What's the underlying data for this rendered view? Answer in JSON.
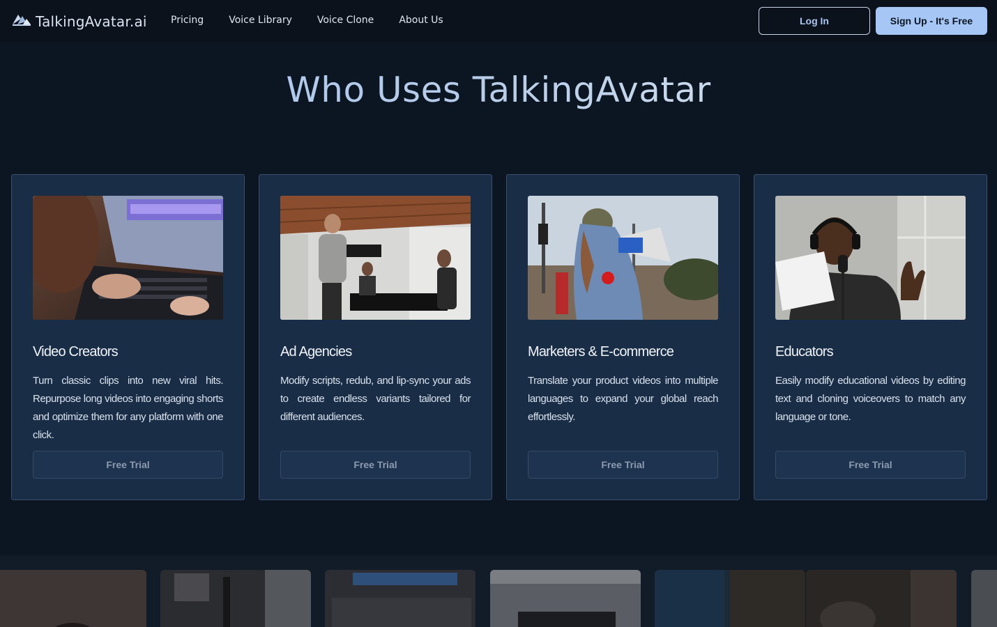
{
  "nav": {
    "brand": "TalkingAvatar.ai",
    "links": [
      "Pricing",
      "Voice Library",
      "Voice Clone",
      "About Us"
    ],
    "login_label": "Log In",
    "signup_label": "Sign Up - It's Free"
  },
  "section": {
    "title": "Who Uses TalkingAvatar"
  },
  "cards": [
    {
      "title": "Video Creators",
      "description": "Turn classic clips into new viral hits. Repurpose long videos into engaging shorts and optimize them for any platform with one click.",
      "button": "Free Trial"
    },
    {
      "title": "Ad Agencies",
      "description": "Modify scripts, redub, and lip-sync your ads to create endless variants tailored for different audiences.",
      "button": "Free Trial"
    },
    {
      "title": "Marketers & E-commerce",
      "description": "Translate your product videos into multiple languages to expand your global reach effortlessly.",
      "button": "Free Trial"
    },
    {
      "title": "Educators",
      "description": "Easily modify educational videos by editing text and cloning voiceovers to match any language or tone.",
      "button": "Free Trial"
    }
  ],
  "colors": {
    "background": "#0c1623",
    "nav_background": "#0b121b",
    "card_background": "#1a2d47",
    "accent": "#a6c7f5"
  }
}
